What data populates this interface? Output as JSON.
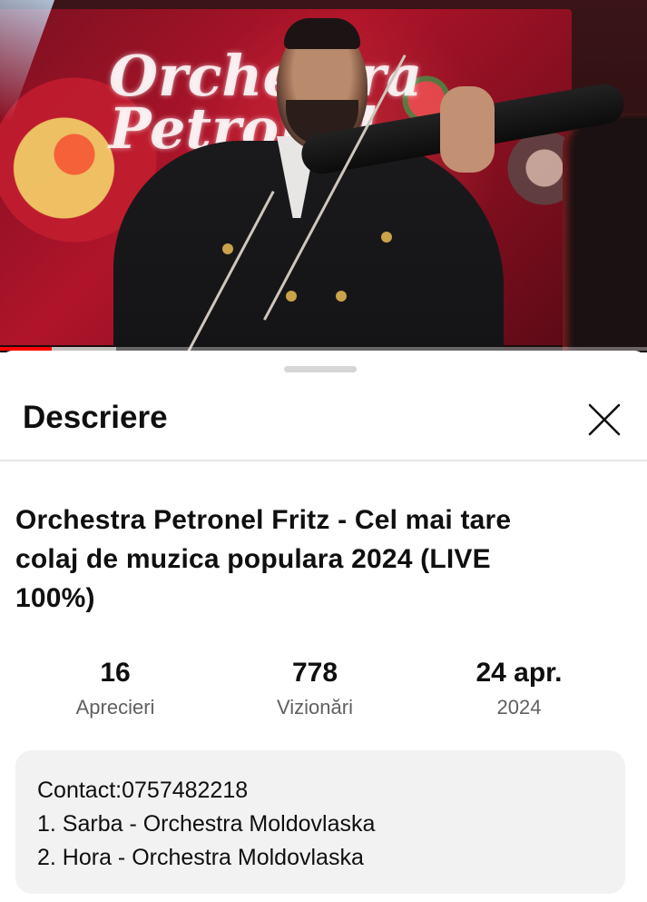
{
  "sheet": {
    "title": "Descriere",
    "close_icon": "close-icon"
  },
  "video": {
    "stage_logo_line1": "Orchestra",
    "stage_logo_line2": "Petronel",
    "title": "Orchestra Petronel Fritz - Cel mai tare colaj de muzica populara 2024 (LIVE 100%)",
    "progress": 0.08,
    "buffered": 0.18,
    "colors": {
      "progress_fill": "#ff0000"
    }
  },
  "stats": [
    {
      "value": "16",
      "label": "Aprecieri"
    },
    {
      "value": "778",
      "label": "Vizionări"
    },
    {
      "value": "24 apr.",
      "label": "2024"
    }
  ],
  "description": {
    "lines": [
      "Contact:0757482218",
      "1. Sarba - Orchestra Moldovlaska",
      "2. Hora - Orchestra Moldovlaska"
    ]
  }
}
